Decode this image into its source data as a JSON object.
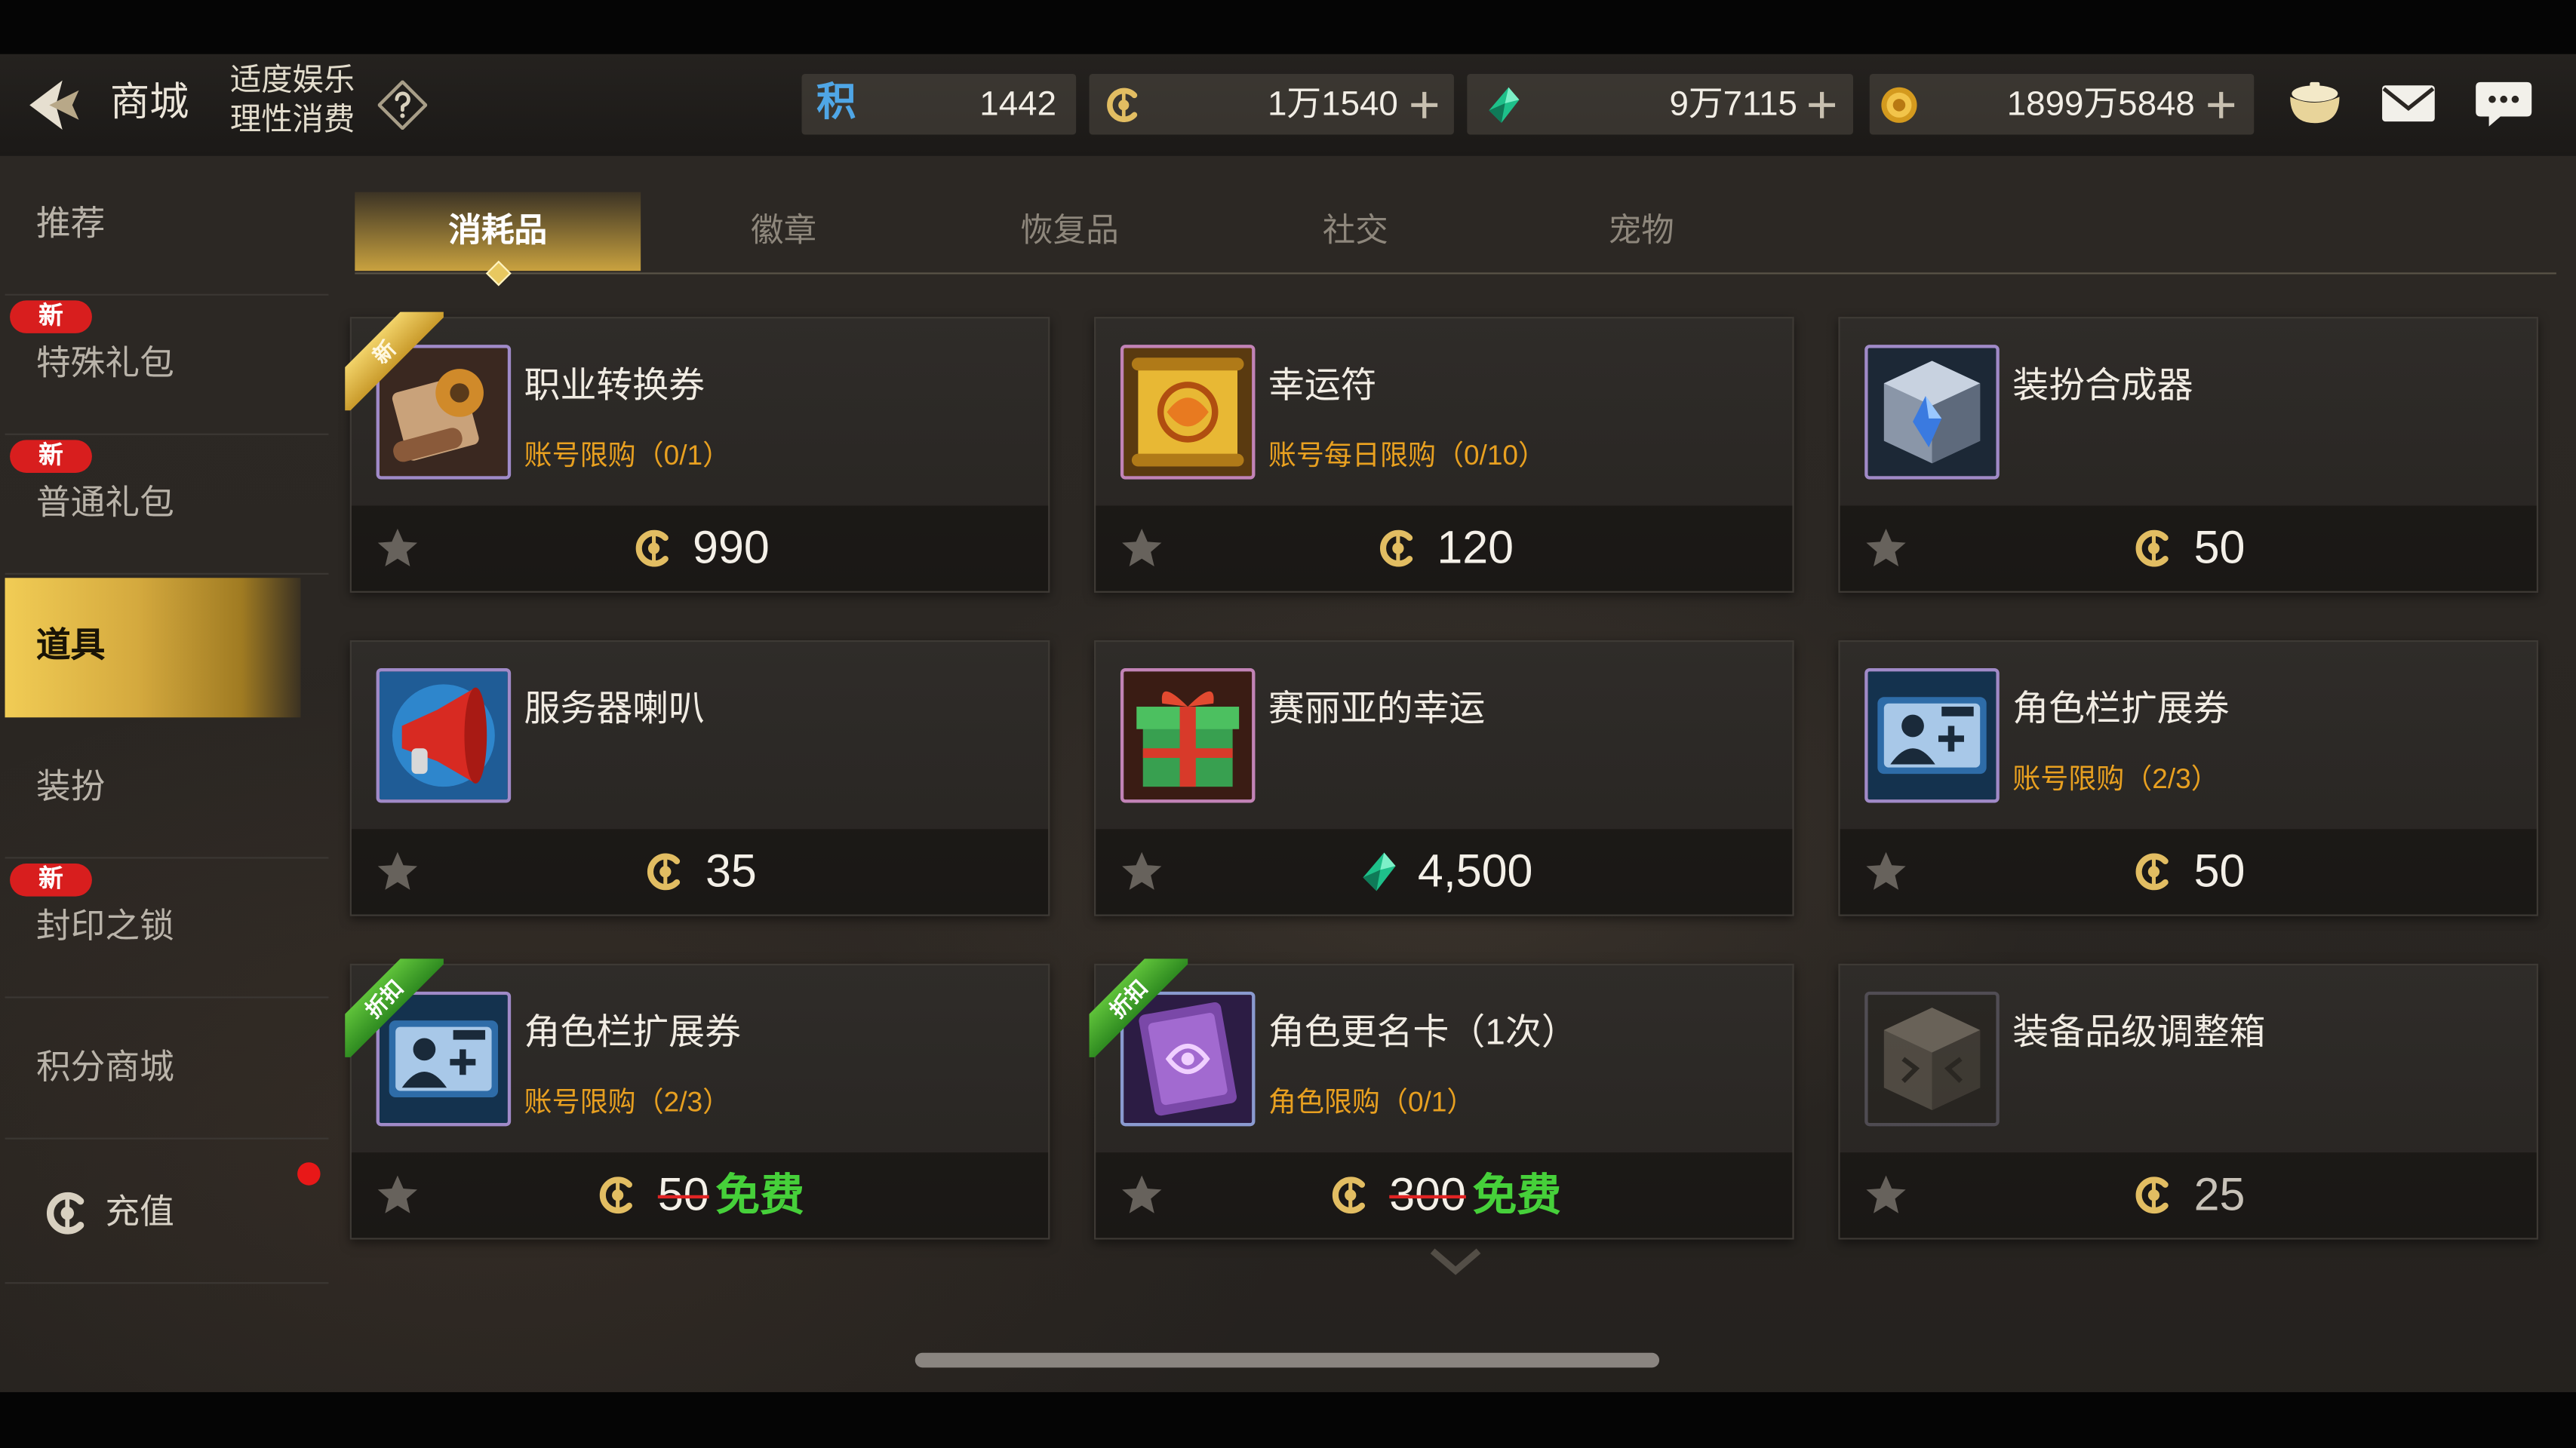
{
  "header": {
    "title": "商城",
    "notice_line1": "适度娱乐",
    "notice_line2": "理性消费"
  },
  "currencies": {
    "points": {
      "glyph": "积",
      "value": "1442"
    },
    "coin": {
      "value": "1万1540"
    },
    "gem": {
      "value": "9万7115"
    },
    "gold": {
      "value": "1899万5848"
    }
  },
  "toolbar_icons": [
    "chest-icon",
    "mail-icon",
    "chat-icon"
  ],
  "sidebar": {
    "new_badge": "新",
    "items": [
      {
        "label": "推荐",
        "new": false
      },
      {
        "label": "特殊礼包",
        "new": true
      },
      {
        "label": "普通礼包",
        "new": true
      },
      {
        "label": "道具",
        "new": false,
        "selected": true
      },
      {
        "label": "装扮",
        "new": false
      },
      {
        "label": "封印之锁",
        "new": true
      },
      {
        "label": "积分商城",
        "new": false
      },
      {
        "label": "充值",
        "new": false,
        "icon": "coin-icon",
        "notification": true
      }
    ]
  },
  "tabs": [
    {
      "label": "消耗品",
      "selected": true
    },
    {
      "label": "徽章"
    },
    {
      "label": "恢复品"
    },
    {
      "label": "社交"
    },
    {
      "label": "宠物"
    }
  ],
  "items": [
    {
      "name": "职业转换券",
      "limit": "账号限购（0/1）",
      "currency": "coin",
      "price": "990",
      "ribbon": "新",
      "ribbon_style": "gold",
      "icon": "job-change-scroll-icon",
      "frame_color": "#a08ac8"
    },
    {
      "name": "幸运符",
      "limit": "账号每日限购（0/10）",
      "currency": "coin",
      "price": "120",
      "icon": "lucky-charm-icon",
      "frame_color": "#c283b6"
    },
    {
      "name": "装扮合成器",
      "currency": "coin",
      "price": "50",
      "icon": "avatar-synthesizer-icon",
      "frame_color": "#a08ac8"
    },
    {
      "name": "服务器喇叭",
      "currency": "coin",
      "price": "35",
      "icon": "server-megaphone-icon",
      "frame_color": "#a08ac8"
    },
    {
      "name": "赛丽亚的幸运",
      "currency": "gem",
      "price": "4,500",
      "icon": "seria-luck-gift-icon",
      "frame_color": "#c283b6"
    },
    {
      "name": "角色栏扩展券",
      "limit": "账号限购（2/3）",
      "currency": "coin",
      "price": "50",
      "icon": "character-slot-ticket-icon",
      "frame_color": "#a08ac8"
    },
    {
      "name": "角色栏扩展券",
      "limit": "账号限购（2/3）",
      "currency": "coin",
      "original_price": "50",
      "price": "免费",
      "ribbon": "折扣",
      "ribbon_style": "green",
      "icon": "character-slot-ticket-icon",
      "frame_color": "#a08ac8"
    },
    {
      "name": "角色更名卡（1次）",
      "limit": "角色限购（0/1）",
      "currency": "coin",
      "original_price": "300",
      "price": "免费",
      "ribbon": "折扣",
      "ribbon_style": "green",
      "icon": "rename-card-icon",
      "frame_color": "#8a9ad0"
    },
    {
      "name": "装备品级调整箱",
      "currency": "coin",
      "price": "25",
      "icon": "equipment-grade-box-icon",
      "frame_color": "#6e6a78",
      "available": false
    }
  ],
  "colors": {
    "accent_gold": "#d4a93e",
    "limit_text": "#e8a020",
    "free_text": "#46d03a",
    "strike": "#e02424",
    "new_badge": "#d81e1e",
    "points_glyph": "#4fa6e6"
  }
}
